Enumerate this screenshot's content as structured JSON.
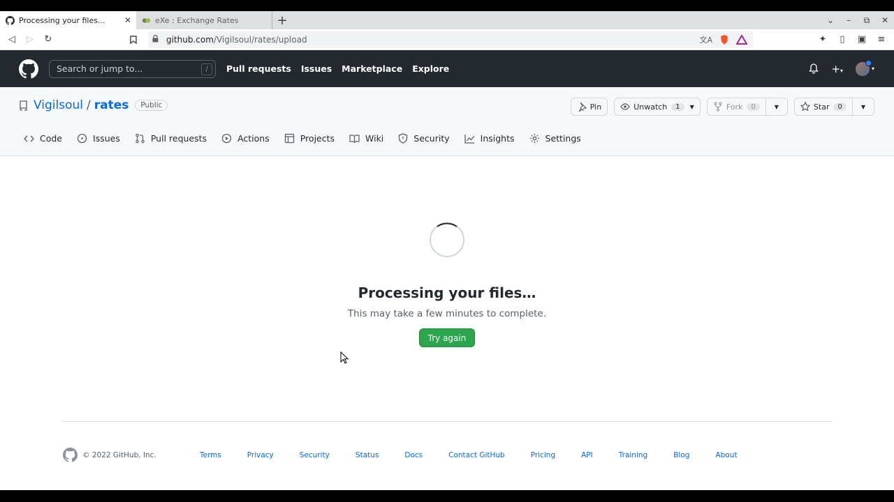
{
  "browser": {
    "tabs": [
      {
        "title": "Processing your files...",
        "active": true
      },
      {
        "title": "eXe : Exchange Rates",
        "active": false
      }
    ],
    "url_host": "github.com",
    "url_path": "/Vigilsoul/rates/upload"
  },
  "header": {
    "search_placeholder": "Search or jump to...",
    "search_shortcut": "/",
    "nav": [
      "Pull requests",
      "Issues",
      "Marketplace",
      "Explore"
    ]
  },
  "repo": {
    "owner": "Vigilsoul",
    "separator": "/",
    "name": "rates",
    "visibility": "Public",
    "pin_label": "Pin",
    "unwatch_label": "Unwatch",
    "unwatch_count": "1",
    "fork_label": "Fork",
    "fork_count": "0",
    "star_label": "Star",
    "star_count": "0",
    "tabs": [
      "Code",
      "Issues",
      "Pull requests",
      "Actions",
      "Projects",
      "Wiki",
      "Security",
      "Insights",
      "Settings"
    ]
  },
  "main": {
    "title": "Processing your files…",
    "subtitle": "This may take a few minutes to complete.",
    "button": "Try again"
  },
  "footer": {
    "copyright": "© 2022 GitHub, Inc.",
    "links": [
      "Terms",
      "Privacy",
      "Security",
      "Status",
      "Docs",
      "Contact GitHub",
      "Pricing",
      "API",
      "Training",
      "Blog",
      "About"
    ]
  },
  "colors": {
    "header_bg": "#24292f",
    "link": "#0969da",
    "primary_button": "#2da44e"
  }
}
